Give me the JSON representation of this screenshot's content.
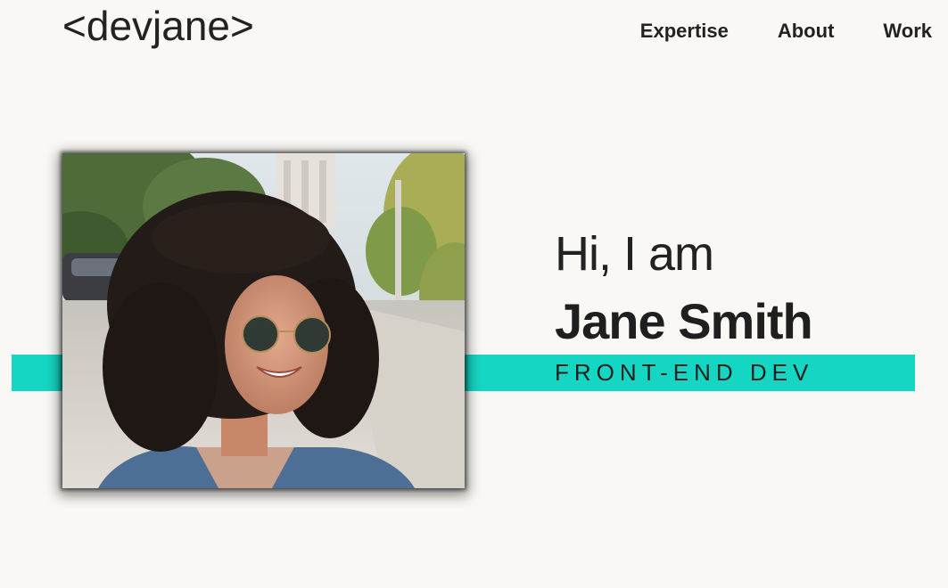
{
  "brand": {
    "logo_text": "<devjane>"
  },
  "nav": {
    "items": [
      {
        "label": "Expertise"
      },
      {
        "label": "About"
      },
      {
        "label": "Work"
      }
    ]
  },
  "hero": {
    "greeting": "Hi, I am",
    "name": "Jane Smith",
    "role": "FRONT-END DEV",
    "photo_alt": "Jane Smith portrait",
    "accent_color": "#14d6c2"
  },
  "colors": {
    "background": "#f9f8f4",
    "text": "#1f1f1f",
    "accent": "#14d6c2"
  }
}
